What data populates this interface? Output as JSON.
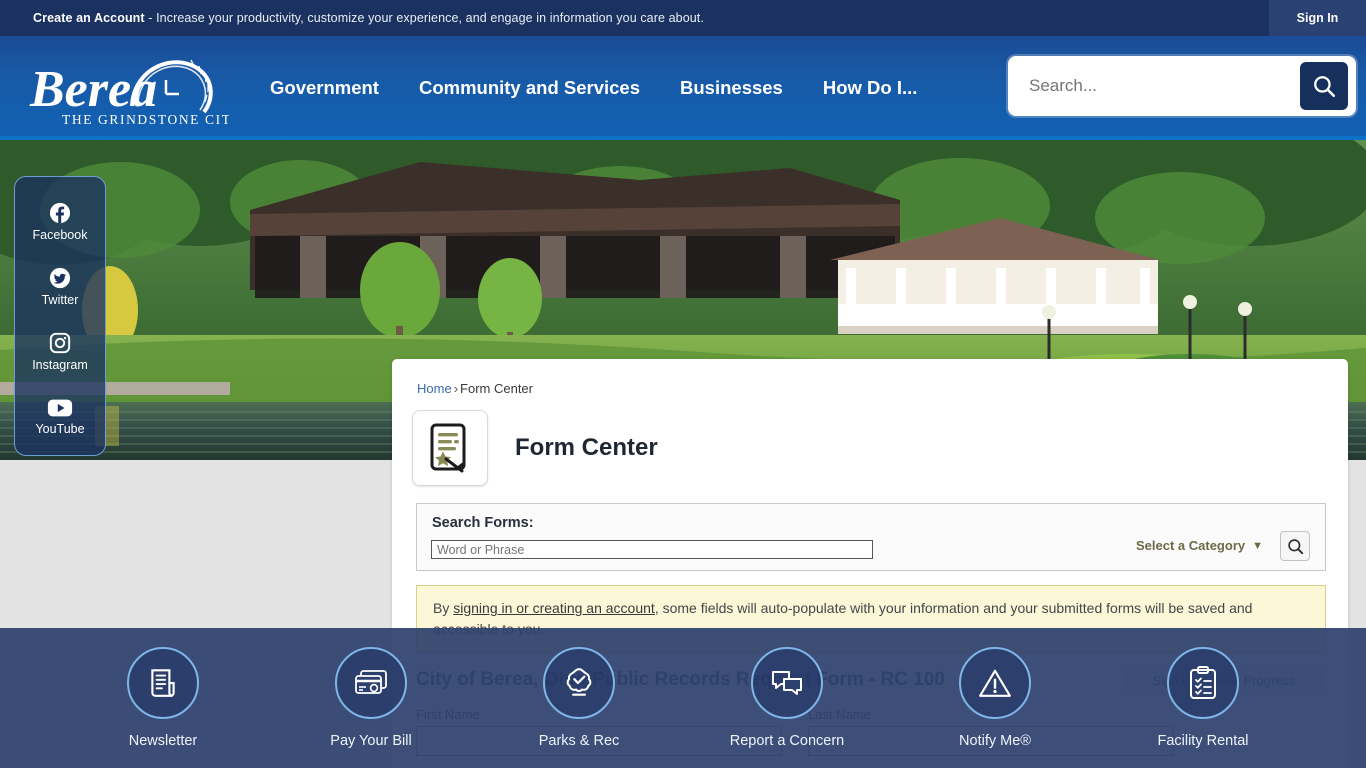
{
  "utility": {
    "create_account_bold": "Create an Account",
    "create_account_rest": " - Increase your productivity, customize your experience, and engage in information you care about.",
    "sign_in": "Sign In"
  },
  "brand": {
    "name": "Berea",
    "tagline": "THE GRINDSTONE CITY"
  },
  "nav": {
    "items": [
      {
        "label": "Government"
      },
      {
        "label": "Community and Services"
      },
      {
        "label": "Businesses"
      },
      {
        "label": "How Do I..."
      }
    ]
  },
  "search": {
    "placeholder": "Search...",
    "value": ""
  },
  "social": {
    "items": [
      {
        "label": "Facebook",
        "icon": "facebook-icon"
      },
      {
        "label": "Twitter",
        "icon": "twitter-icon"
      },
      {
        "label": "Instagram",
        "icon": "instagram-icon"
      },
      {
        "label": "YouTube",
        "icon": "youtube-icon"
      }
    ]
  },
  "breadcrumb": {
    "home": "Home",
    "separator": "›",
    "current": "Form Center"
  },
  "page": {
    "title": "Form Center",
    "icon": "form-center-icon"
  },
  "form_search": {
    "label": "Search Forms:",
    "input_placeholder": "Word or Phrase",
    "input_value": "",
    "category_label": "Select a Category",
    "category_caret": "▼",
    "search_icon": "magnifier-icon"
  },
  "notice": {
    "prefix": "By ",
    "link": "signing in or creating an account",
    "rest": ", some fields will auto-populate with your information and your submitted forms will be saved and accessible to you."
  },
  "active_form": {
    "title": "City of Berea, Ohio Public Records Request Form - RC 100",
    "sign_in_save": "Sign in to Save Progress",
    "fields": [
      {
        "label": "First Name",
        "value": ""
      },
      {
        "label": "Last Name",
        "value": ""
      }
    ]
  },
  "quicklinks": {
    "items": [
      {
        "label": "Newsletter",
        "icon": "newsletter-icon"
      },
      {
        "label": "Pay Your Bill",
        "icon": "credit-card-icon"
      },
      {
        "label": "Parks & Rec",
        "icon": "tree-check-icon"
      },
      {
        "label": "Report a Concern",
        "icon": "chat-bubbles-icon"
      },
      {
        "label": "Notify Me®",
        "icon": "alert-triangle-icon"
      },
      {
        "label": "Facility Rental",
        "icon": "clipboard-checklist-icon"
      }
    ]
  },
  "colors": {
    "utility_bar": "#1b3260",
    "header_blue": "#1260b4",
    "accent_light_blue": "#7fb6e8",
    "page_bg": "#e3e3e3",
    "notice_bg": "#fcf7d6",
    "category_olive": "#6b6a45"
  }
}
